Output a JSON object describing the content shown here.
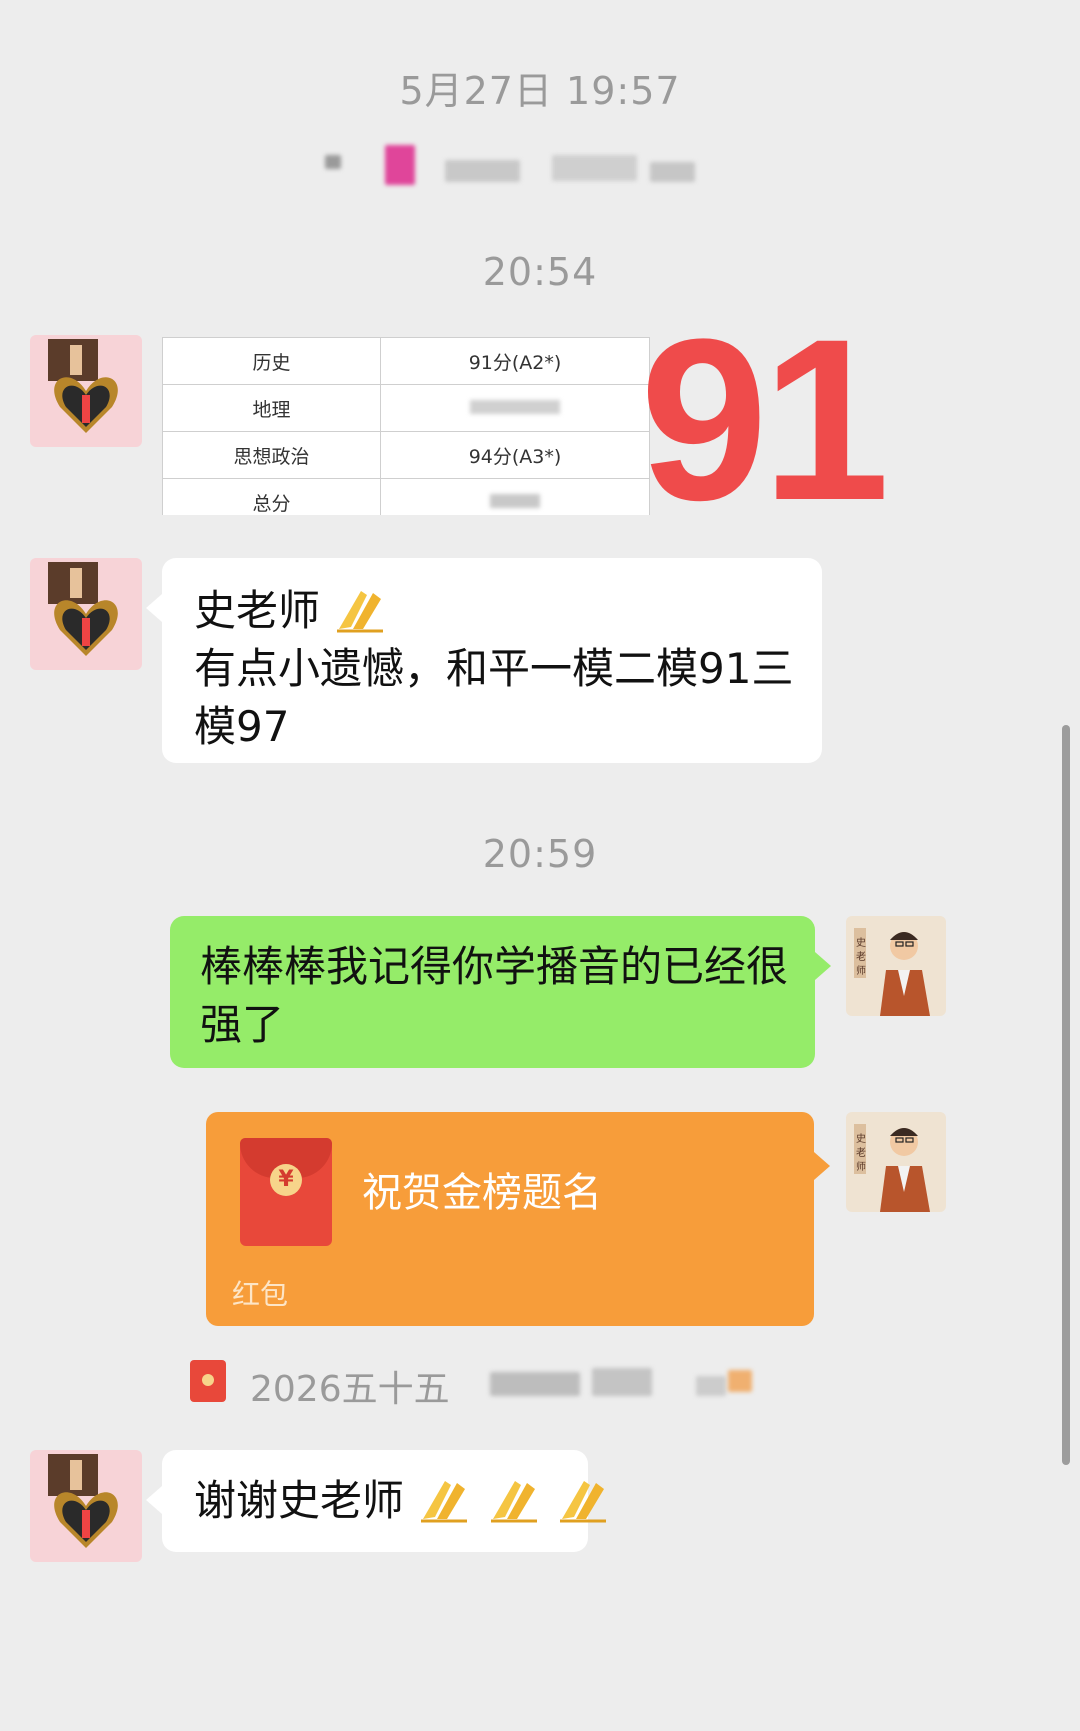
{
  "timestamps": [
    "5月27日 19:57",
    "20:54",
    "20:59"
  ],
  "score_table": {
    "rows": [
      {
        "subject": "历史",
        "score": "91分(A2*)"
      },
      {
        "subject": "地理",
        "score": ""
      },
      {
        "subject": "思想政治",
        "score": "94分(A3*)"
      },
      {
        "subject": "总分",
        "score": ""
      }
    ],
    "overlay_number": "91"
  },
  "messages": {
    "msg1_line1": "史老师",
    "msg1_line2": "有点小遗憾，和平一模二模91三",
    "msg1_line3": "模97",
    "msg2_line1": "棒棒棒我记得你学播音的已经很",
    "msg2_line2": "强了",
    "msg4": "谢谢史老师"
  },
  "red_packet": {
    "title": "祝贺金榜题名",
    "footer": "红包",
    "currency_symbol": "¥"
  },
  "system_notice": {
    "text": "2026五十五"
  },
  "colors": {
    "background": "#ededed",
    "green_bubble": "#95ec69",
    "red_packet": "#f79d3a",
    "overlay_red": "#ef4b4b"
  }
}
